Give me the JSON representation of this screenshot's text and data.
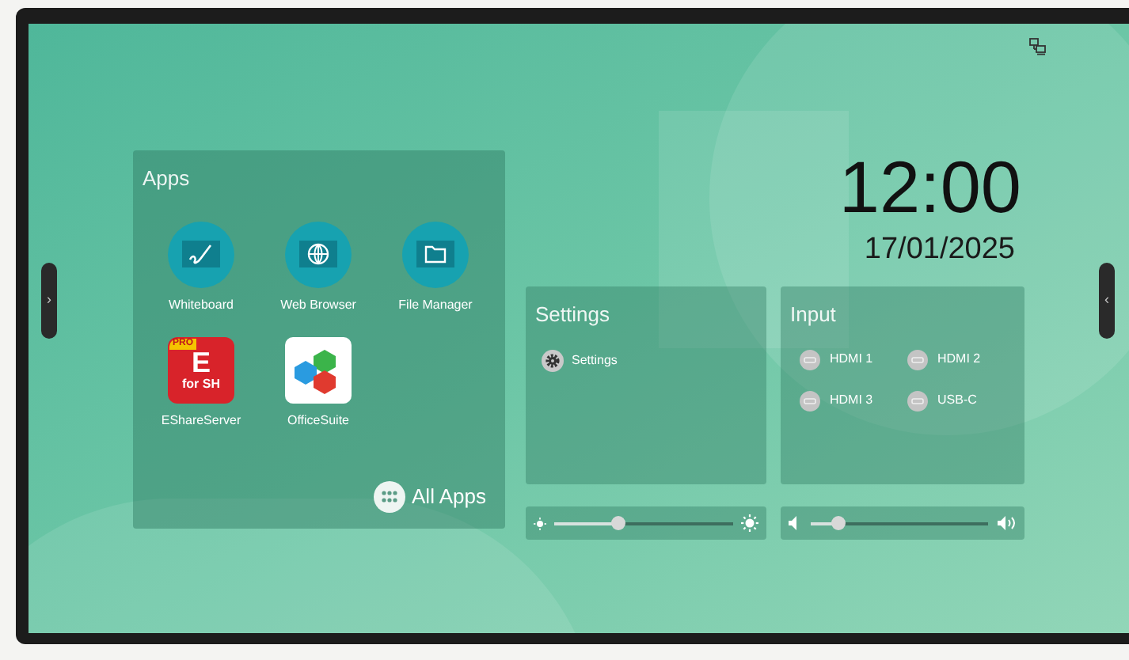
{
  "handles": {
    "left": "›",
    "right": "‹"
  },
  "apps_panel": {
    "title": "Apps",
    "apps": [
      {
        "kind": "whiteboard",
        "label": "Whiteboard"
      },
      {
        "kind": "browser",
        "label": "Web Browser"
      },
      {
        "kind": "files",
        "label": "File Manager"
      },
      {
        "kind": "eshare",
        "label": "EShareServer",
        "badge": "PRO",
        "logo_text": "E",
        "logo_subtext": "for SH"
      },
      {
        "kind": "office",
        "label": "OfficeSuite"
      }
    ],
    "all_apps": "All Apps"
  },
  "clock": {
    "time": "12:00",
    "date": "17/01/2025"
  },
  "settings_panel": {
    "title": "Settings",
    "items": [
      {
        "label": "Settings"
      }
    ]
  },
  "input_panel": {
    "title": "Input",
    "sources": [
      {
        "label": "HDMI 1"
      },
      {
        "label": "HDMI 2"
      },
      {
        "label": "HDMI 3"
      },
      {
        "label": "USB-C"
      }
    ]
  },
  "brightness": {
    "level": 0.35
  },
  "volume": {
    "level": 0.15
  }
}
